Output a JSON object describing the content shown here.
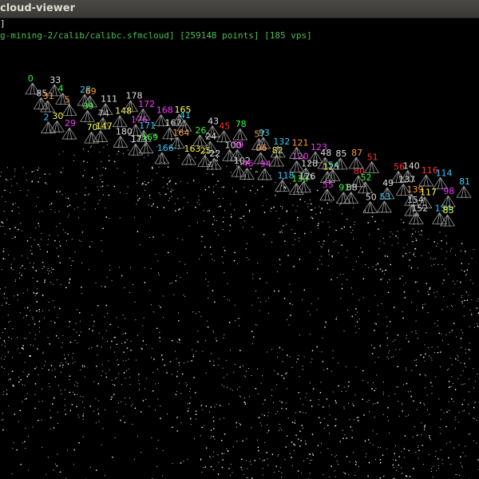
{
  "window": {
    "title": "cloud-viewer"
  },
  "toolbar": {
    "text": "]"
  },
  "status": {
    "path": "g-mining-2/calib/calibc.sfmcloud]",
    "points": "[259148 points]",
    "vps": "[185 vps]"
  },
  "viewpoint_labels": [
    {
      "text": "0",
      "color": "#33ff33"
    },
    {
      "text": "85",
      "color": "#e0e0e0"
    },
    {
      "text": "2",
      "color": "#33ccff"
    },
    {
      "text": "33",
      "color": "#e0e0e0"
    },
    {
      "text": "31",
      "color": "#ff9933"
    },
    {
      "text": "30",
      "color": "#ffff33"
    },
    {
      "text": "4",
      "color": "#33ff33"
    },
    {
      "text": "5",
      "color": "#ff9933"
    },
    {
      "text": "29",
      "color": "#ff33ff"
    },
    {
      "text": "28",
      "color": "#33ccff"
    },
    {
      "text": "39",
      "color": "#33ff33"
    },
    {
      "text": "70",
      "color": "#ffff33"
    },
    {
      "text": "69",
      "color": "#ff9933"
    },
    {
      "text": "74",
      "color": "#e0e0e0"
    },
    {
      "text": "147",
      "color": "#ffff33"
    },
    {
      "text": "111",
      "color": "#e0e0e0"
    },
    {
      "text": "148",
      "color": "#ffff33"
    },
    {
      "text": "180",
      "color": "#e0e0e0"
    },
    {
      "text": "178",
      "color": "#e0e0e0"
    },
    {
      "text": "176",
      "color": "#ff33ff"
    },
    {
      "text": "173",
      "color": "#e0e0e0"
    },
    {
      "text": "172",
      "color": "#ff33ff"
    },
    {
      "text": "171",
      "color": "#33ccff"
    },
    {
      "text": "169",
      "color": "#33ff33"
    },
    {
      "text": "168",
      "color": "#ff33ff"
    },
    {
      "text": "167",
      "color": "#e0e0e0"
    },
    {
      "text": "166",
      "color": "#33ccff"
    },
    {
      "text": "165",
      "color": "#ffff33"
    },
    {
      "text": "164",
      "color": "#ff9933"
    },
    {
      "text": "163",
      "color": "#ffff33"
    },
    {
      "text": "41",
      "color": "#33ccff"
    },
    {
      "text": "26",
      "color": "#33ff33"
    },
    {
      "text": "25",
      "color": "#ffff33"
    },
    {
      "text": "43",
      "color": "#e0e0e0"
    },
    {
      "text": "24",
      "color": "#e0e0e0"
    },
    {
      "text": "22",
      "color": "#e0e0e0"
    },
    {
      "text": "45",
      "color": "#ff3333"
    },
    {
      "text": "100",
      "color": "#e0e0e0"
    },
    {
      "text": "102",
      "color": "#e0e0e0"
    },
    {
      "text": "78",
      "color": "#33ff33"
    },
    {
      "text": "59",
      "color": "#ff33ff"
    },
    {
      "text": "46",
      "color": "#ff33ff"
    },
    {
      "text": "57",
      "color": "#ff9933"
    },
    {
      "text": "96",
      "color": "#ff9933"
    },
    {
      "text": "94",
      "color": "#ff33ff"
    },
    {
      "text": "93",
      "color": "#33ccff"
    },
    {
      "text": "82",
      "color": "#ffff33"
    },
    {
      "text": "118",
      "color": "#33ccff"
    },
    {
      "text": "132",
      "color": "#33ccff"
    },
    {
      "text": "120",
      "color": "#ff33ff"
    },
    {
      "text": "130",
      "color": "#33ff33"
    },
    {
      "text": "121",
      "color": "#ff9933"
    },
    {
      "text": "128",
      "color": "#e0e0e0"
    },
    {
      "text": "126",
      "color": "#e0e0e0"
    },
    {
      "text": "123",
      "color": "#ff33ff"
    },
    {
      "text": "125",
      "color": "#ffff33"
    },
    {
      "text": "55",
      "color": "#ff33ff"
    },
    {
      "text": "48",
      "color": "#e0e0e0"
    },
    {
      "text": "54",
      "color": "#33ccff"
    },
    {
      "text": "91",
      "color": "#33ff33"
    },
    {
      "text": "85",
      "color": "#e0e0e0"
    },
    {
      "text": "80",
      "color": "#ff3333"
    },
    {
      "text": "88",
      "color": "#e0e0e0"
    },
    {
      "text": "87",
      "color": "#ff9933"
    },
    {
      "text": "52",
      "color": "#33ff33"
    },
    {
      "text": "50",
      "color": "#e0e0e0"
    },
    {
      "text": "51",
      "color": "#ff3333"
    },
    {
      "text": "49",
      "color": "#e0e0e0"
    },
    {
      "text": "53",
      "color": "#33ccff"
    },
    {
      "text": "56",
      "color": "#ff3333"
    },
    {
      "text": "137",
      "color": "#e0e0e0"
    },
    {
      "text": "154",
      "color": "#e0e0e0"
    },
    {
      "text": "140",
      "color": "#e0e0e0"
    },
    {
      "text": "139",
      "color": "#ff9933"
    },
    {
      "text": "152",
      "color": "#e0e0e0"
    },
    {
      "text": "116",
      "color": "#ff3333"
    },
    {
      "text": "117",
      "color": "#ffff33"
    },
    {
      "text": "134",
      "color": "#33ccff"
    },
    {
      "text": "114",
      "color": "#33ccff"
    },
    {
      "text": "98",
      "color": "#ff33ff"
    },
    {
      "text": "83",
      "color": "#ffff33"
    },
    {
      "text": "81",
      "color": "#33ccff"
    }
  ],
  "colors": {
    "titlebar": "#3d3c38",
    "title_text": "#dfdbd2",
    "status_text": "#4fbd53",
    "point_cloud": "#ffffff",
    "camera_frustum": "#9a9a9a",
    "background": "#000000"
  }
}
